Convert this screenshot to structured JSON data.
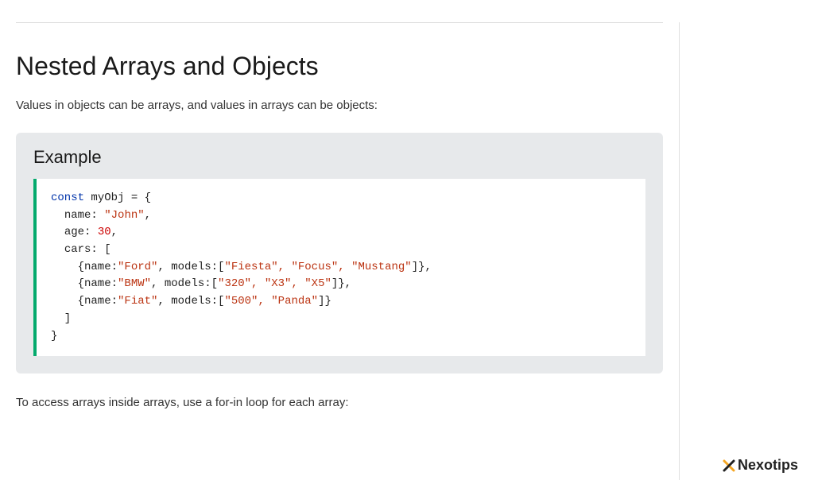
{
  "page": {
    "title": "Nested Arrays and Objects",
    "intro": "Values in objects can be arrays, and values in arrays can be objects:",
    "outro": "To access arrays inside arrays, use a for-in loop for each array:"
  },
  "example": {
    "label": "Example",
    "code": {
      "keyword": "const",
      "varname": "myObj",
      "prop_name": "name",
      "val_name": "\"John\"",
      "prop_age": "age",
      "val_age": "30",
      "prop_cars": "cars",
      "car1_name": "\"Ford\"",
      "car1_models": "\"Fiesta\", \"Focus\", \"Mustang\"",
      "car2_name": "\"BMW\"",
      "car2_models": "\"320\", \"X3\", \"X5\"",
      "car3_name": "\"Fiat\"",
      "car3_models": "\"500\", \"Panda\""
    }
  },
  "brand": {
    "name": "Nexotips"
  }
}
